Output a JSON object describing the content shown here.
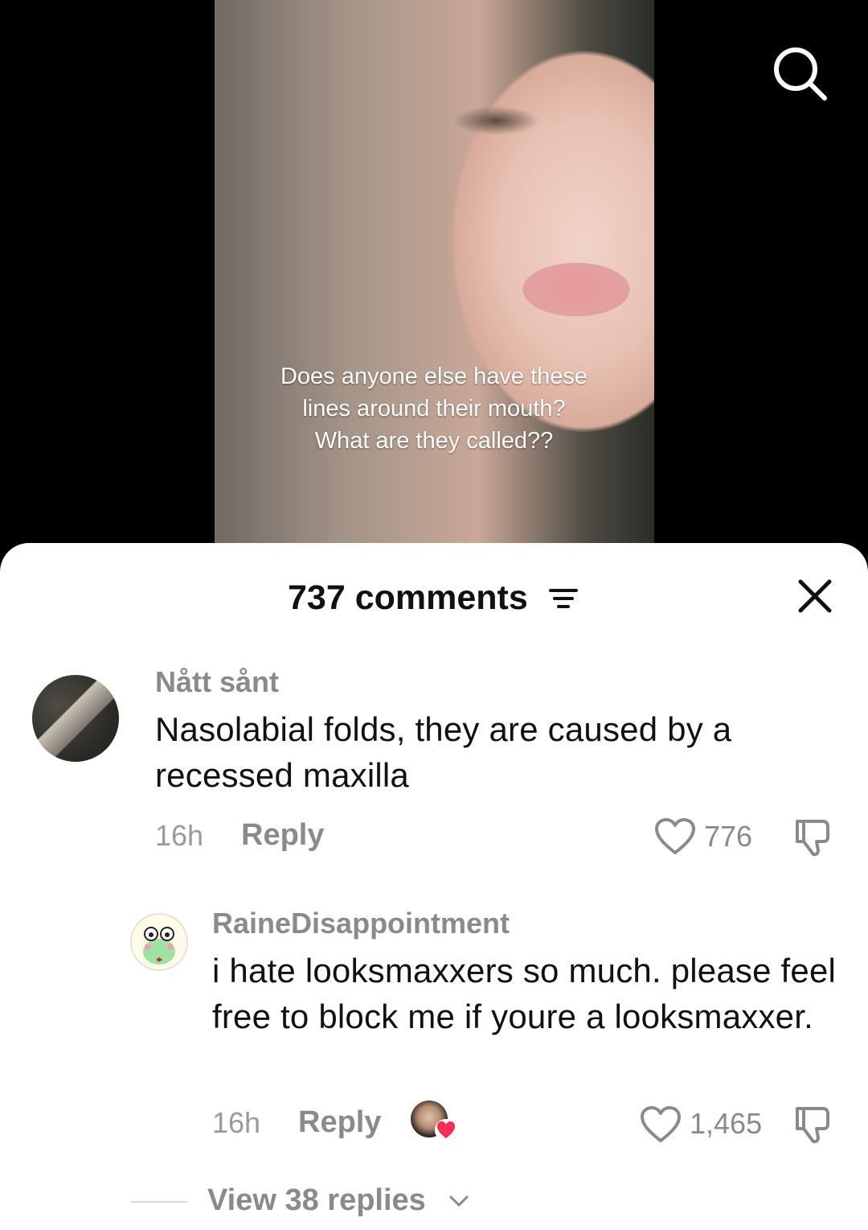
{
  "video": {
    "caption": "Does anyone else have these lines around their mouth? What are they called??"
  },
  "header": {
    "comment_count": "737 comments"
  },
  "comments": [
    {
      "username": "Nått sånt",
      "text": "Nasolabial folds, they are caused by a recessed maxilla",
      "time": "16h",
      "reply_label": "Reply",
      "likes": "776"
    },
    {
      "username": "RaineDisappointment",
      "text": "i hate looksmaxxers so much. please feel free to block me if youre a looksmaxxer.",
      "time": "16h",
      "reply_label": "Reply",
      "likes": "1,465",
      "liked_by_creator": true,
      "view_replies": "View 38 replies"
    }
  ],
  "icons": {
    "search": "search-icon",
    "filter": "filter-icon",
    "close": "close-icon",
    "like": "heart-outline-icon",
    "dislike": "thumbs-down-icon",
    "creator_liked": "heart-filled-icon",
    "expand": "chevron-down-icon"
  },
  "colors": {
    "sheet_bg": "#ffffff",
    "muted_text": "#8a8a8a",
    "heart_red": "#fe2c55"
  }
}
